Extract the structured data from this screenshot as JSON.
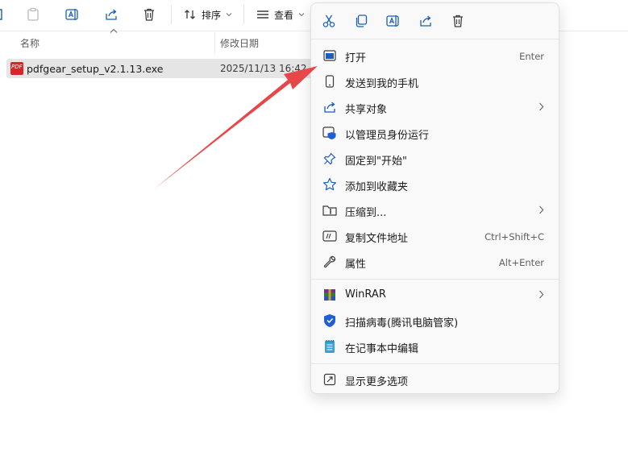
{
  "toolbar": {
    "sort_label": "排序",
    "view_label": "查看"
  },
  "columns": {
    "name": "名称",
    "modified": "修改日期"
  },
  "file": {
    "name": "pdfgear_setup_v2.1.13.exe",
    "modified": "2025/11/13 16:42",
    "icon_text": "PDF"
  },
  "context_menu": {
    "quick_actions": [
      "cut-icon",
      "copy-icon",
      "rename-icon",
      "share-icon",
      "delete-icon"
    ],
    "items": [
      {
        "label": "打开",
        "shortcut": "Enter",
        "icon": "open-icon"
      },
      {
        "label": "发送到我的手机",
        "shortcut": "",
        "icon": "phone-icon"
      },
      {
        "label": "共享对象",
        "shortcut": "",
        "icon": "share-icon",
        "submenu": true
      },
      {
        "label": "以管理员身份运行",
        "shortcut": "",
        "icon": "admin-shield-icon"
      },
      {
        "label": "固定到\"开始\"",
        "shortcut": "",
        "icon": "pin-icon"
      },
      {
        "label": "添加到收藏夹",
        "shortcut": "",
        "icon": "star-icon"
      },
      {
        "label": "压缩到...",
        "shortcut": "",
        "icon": "zip-icon",
        "submenu": true
      },
      {
        "label": "复制文件地址",
        "shortcut": "Ctrl+Shift+C",
        "icon": "copy-path-icon"
      },
      {
        "label": "属性",
        "shortcut": "Alt+Enter",
        "icon": "wrench-icon"
      },
      {
        "label": "WinRAR",
        "shortcut": "",
        "icon": "winrar-icon",
        "submenu": true
      },
      {
        "label": "扫描病毒(腾讯电脑管家)",
        "shortcut": "",
        "icon": "tencent-shield-icon"
      },
      {
        "label": "在记事本中编辑",
        "shortcut": "",
        "icon": "notepad-icon"
      },
      {
        "label": "显示更多选项",
        "shortcut": "",
        "icon": "more-options-icon"
      }
    ]
  },
  "colors": {
    "annotation_arrow": "#e8474a",
    "selection": "#e5e5e5",
    "menu_bg": "#f9f9f9",
    "admin_shield": "#1f5fd6",
    "file_icon": "#d7262b"
  }
}
